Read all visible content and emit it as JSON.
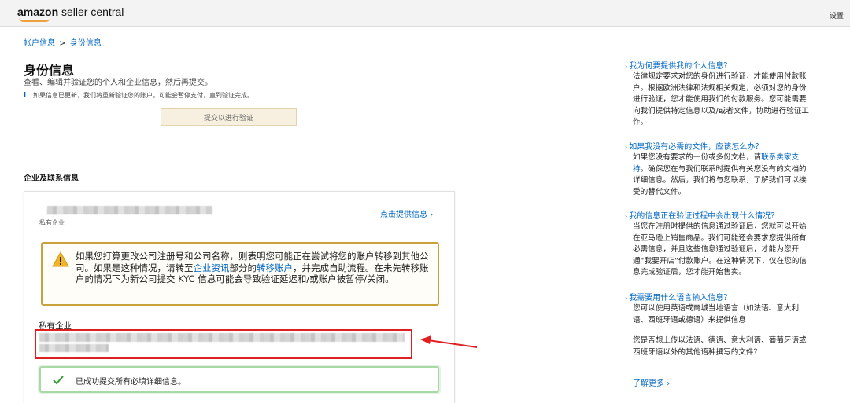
{
  "header": {
    "logo_brand": "amazon",
    "logo_suffix": " seller central",
    "settings_label": "设置"
  },
  "breadcrumb": {
    "item1": "帐户信息",
    "separator": ">",
    "item2": "身份信息"
  },
  "page": {
    "title": "身份信息",
    "subtitle": "查看、编辑并验证您的个人和企业信息，然后再提交。",
    "info_icon": "i",
    "info_note": "如果信息已更新，我们将重新验证您的账户。可能会暂停支付，直到验证完成。",
    "submit_button": "提交以进行验证"
  },
  "section": {
    "title": "企业及联系信息",
    "company_type": "私有企业",
    "provide_link": "点击提供信息",
    "provide_chevron": "›",
    "warning": {
      "part1": "如果您打算更改公司注册号和公司名称，则表明您可能正在尝试将您的账户转移到其他公司。如果是这种情况，请转至",
      "link1": "企业资讯",
      "part2": "部分的",
      "link2": "转移账户",
      "part3": "，并完成自助流程。在未先转移账户的情况下为新公司提交 KYC 信息可能会导致验证延迟和/或账户被暂停/关闭。"
    },
    "company_label": "私有企业",
    "success_text": "已成功提交所有必填详细信息。"
  },
  "sidebar": {
    "caret": "›",
    "faq": [
      {
        "question": "我为何要提供我的个人信息？",
        "answer": "法律规定要求对您的身份进行验证，才能使用付款账户。根据欧洲法律和法规相关规定，必须对您的身份进行验证，您才能使用我们的付款服务。您可能需要向我们提供特定信息以及/或者文件，协助进行验证工作。"
      },
      {
        "question": "如果我没有必需的文件，应该怎么办？",
        "answer_part1": "如果您没有要求的一份或多份文档，请",
        "answer_link": "联系卖家支持",
        "answer_part2": "。确保您在与我们联系时提供有关您没有的文档的详细信息。然后，我们将与您联系，了解我们可以接受的替代文件。"
      },
      {
        "question": "我的信息正在验证过程中会出现什么情况？",
        "answer": "当您在注册时提供的信息通过验证后，您就可以开始在亚马逊上销售商品。我们可能还会要求您提供所有必需信息，并且这些信息通过验证后，才能为您开通“我要开店”付款账户。在这种情况下，仅在您的信息完成验证后，您才能开始售卖。"
      },
      {
        "question": "我需要用什么语言输入信息？",
        "answer": "您可以使用英语或商城当地语言（如法语、意大利语、西班牙语或德语）来提供信息",
        "answer2": "您是否想上传以法语、德语、意大利语、葡萄牙语或西班牙语以外的其他语种撰写的文件？"
      }
    ],
    "learn_more": "了解更多"
  }
}
